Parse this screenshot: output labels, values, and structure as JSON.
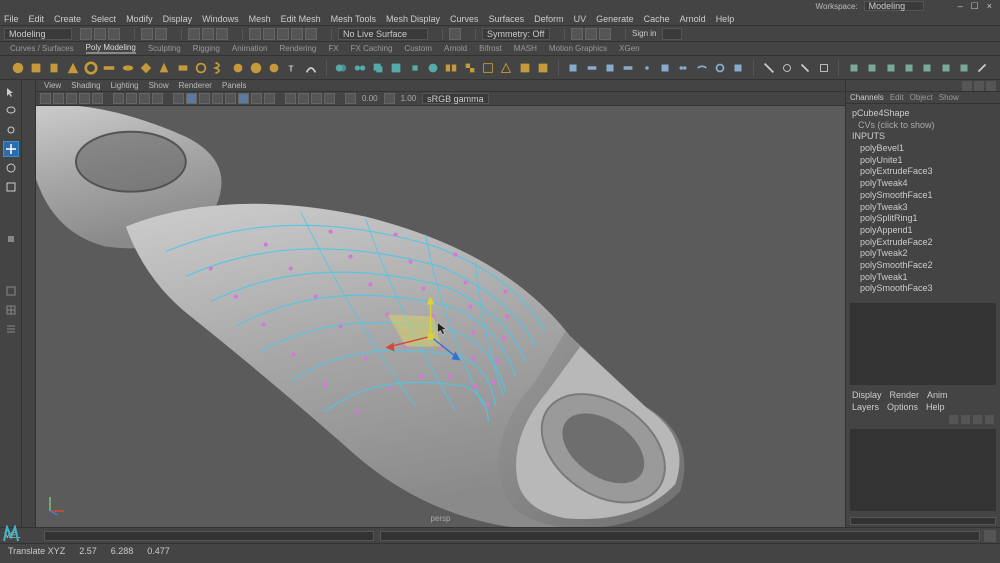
{
  "titlebar": {
    "workspace_label": "Workspace:",
    "workspace_value": "Modeling"
  },
  "menu": [
    "File",
    "Edit",
    "Create",
    "Select",
    "Modify",
    "Display",
    "Windows",
    "Mesh",
    "Edit Mesh",
    "Mesh Tools",
    "Mesh Display",
    "Curves",
    "Surfaces",
    "Deform",
    "UV",
    "Generate",
    "Cache",
    "Arnold",
    "Help"
  ],
  "statusline": {
    "mode": "Modeling",
    "no_live_surface": "No Live Surface",
    "symmetry": "Symmetry: Off",
    "signin": "Sign in"
  },
  "shelftabs": [
    "Curves / Surfaces",
    "Poly Modeling",
    "Sculpting",
    "Rigging",
    "Animation",
    "Rendering",
    "FX",
    "FX Caching",
    "Custom",
    "Arnold",
    "Bifrost",
    "MASH",
    "Motion Graphics",
    "XGen"
  ],
  "shelftabs_active": "Poly Modeling",
  "panelmenu": [
    "View",
    "Shading",
    "Lighting",
    "Show",
    "Renderer",
    "Panels"
  ],
  "paneltoolbar": {
    "val1": "0.00",
    "val2": "1.00",
    "colorspace": "sRGB gamma"
  },
  "viewport": {
    "camera": "persp"
  },
  "channelbox": {
    "tabs": [
      "Channels",
      "Edit",
      "Object",
      "Show"
    ],
    "shape": "pCube4Shape",
    "cvs": "CVs (click to show)",
    "inputs_label": "INPUTS",
    "inputs": [
      "polyBevel1",
      "polyUnite1",
      "polyExtrudeFace3",
      "polyTweak4",
      "polySmoothFace1",
      "polyTweak3",
      "polySplitRing1",
      "polyAppend1",
      "polyExtrudeFace2",
      "polyTweak2",
      "polySmoothFace2",
      "polyTweak1",
      "polySmoothFace3"
    ]
  },
  "attr": {
    "tabs": [
      "Display",
      "Render",
      "Anim"
    ],
    "subtabs": [
      "Layers",
      "Options",
      "Help"
    ]
  },
  "cmdlabel": "MEL",
  "help": [
    "Translate XYZ",
    "2.57",
    "6.288",
    "0.477"
  ]
}
